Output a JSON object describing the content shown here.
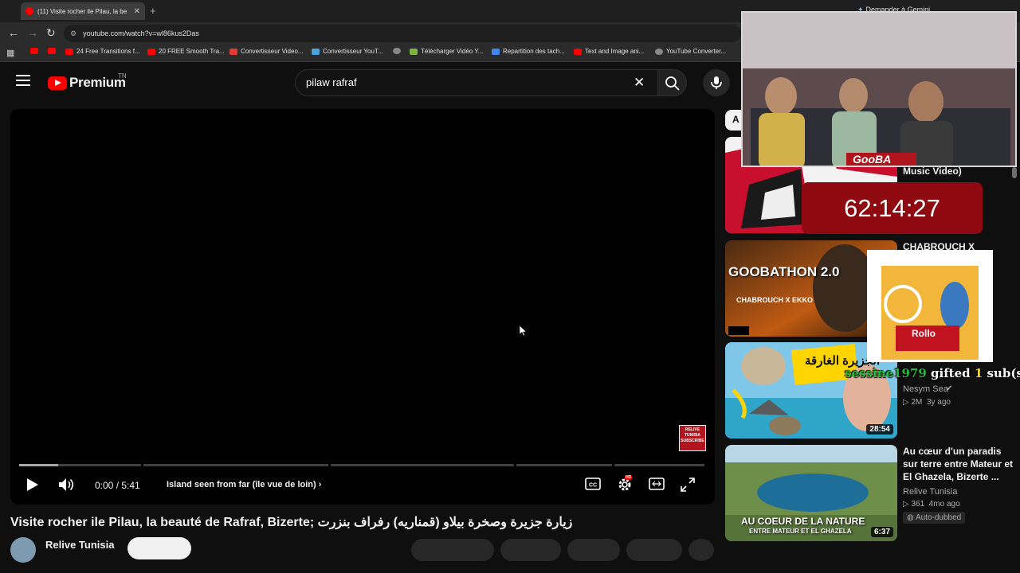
{
  "browser": {
    "tab_title": "(11) Visite rocher ile Pilau, la be",
    "url": "youtube.com/watch?v=wl86kus2Das",
    "gemini_label": "Demander à Gemini",
    "bookmarks": [
      "24 Free Transitions f...",
      "20 FREE Smooth Tra...",
      "Convertisseur Video...",
      "Convertisseur YouT...",
      "Télécharger Vidéo Y...",
      "Repartition des tach...",
      "Text and Image ani...",
      "YouTube Converter..."
    ]
  },
  "youtube": {
    "logo_text": "Premium",
    "country_code": "TN",
    "search_value": "pilaw rafraf"
  },
  "player": {
    "time": "0:00 / 5:41",
    "chapter": "Island seen from far (île vue de loin)",
    "watermark": "RELIVE TUNISIA SUBSCRIBE",
    "hd_badge": "HD"
  },
  "video": {
    "title": "Visite rocher ile Pilau, la beauté de Rafraf, Bizerte; زيارة جزيرة وصخرة بيلاو (قمناريه) رفراف بنزرت",
    "channel": "Relive Tunisia"
  },
  "sidebar": {
    "chip": "A",
    "videos": [
      {
        "title_line": "Music Video)",
        "duration": ""
      },
      {
        "title": "CHABROUCH X EKKO -",
        "thumb_text": "GOOBATHON 2.0",
        "thumb_sub": "CHABROUCH X EKKO"
      },
      {
        "title": "",
        "channel": "Nesym Sea",
        "views": "2M",
        "age": "3y ago",
        "duration": "28:54",
        "thumb_text": "الجزيرة الغارقة"
      },
      {
        "title": "Au cœur d'un paradis sur terre entre Mateur et El Ghazela, Bizerte ...",
        "channel": "Relive Tunisia",
        "views": "361",
        "age": "4mo ago",
        "badge": "Auto-dubbed",
        "duration": "6:37",
        "thumb_text": "AU COEUR DE LA NATURE",
        "thumb_sub": "ENTRE MATEUR ET EL GHAZELA"
      }
    ]
  },
  "overlay": {
    "webcam_label": "GooBA",
    "timer": "62:14:27",
    "rollo_text": "Rollo",
    "gift_user": "sessine1979",
    "gift_text": " gifted ",
    "gift_count": "1",
    "gift_suffix": " sub(s)!"
  },
  "colors": {
    "accent": "#ff0000",
    "timer_bg": "#8e0a10",
    "gift_user": "#1fbe3a"
  }
}
